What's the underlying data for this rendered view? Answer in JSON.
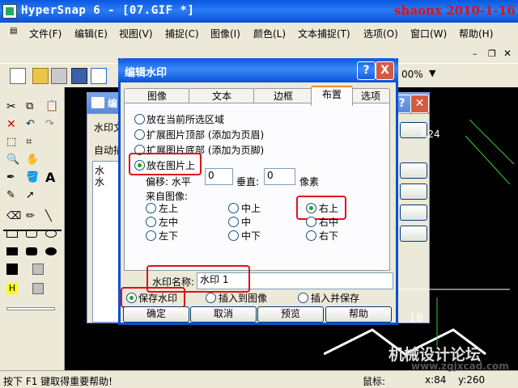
{
  "app": {
    "title": "HyperSnap 6 - [07.GIF *]",
    "watermark": "shaonx 2010-1-16"
  },
  "menubar": [
    "文件(F)",
    "编辑(E)",
    "视图(V)",
    "捕捉(C)",
    "图像(I)",
    "颜色(L)",
    "文本捕捉(T)",
    "选项(O)",
    "窗口(W)",
    "帮助(H)"
  ],
  "toolbar": {
    "zoom": "00%"
  },
  "back_dialog": {
    "title": "编",
    "label1": "水印文",
    "label2": "自动插",
    "list": [
      "水",
      "水"
    ]
  },
  "dialog": {
    "title": "编辑水印",
    "help_btn": "?",
    "close_btn": "X",
    "tabs": [
      "图像",
      "文本",
      "边框",
      "布置",
      "选项"
    ],
    "active_tab": "布置",
    "placement": {
      "options": [
        "放在当前所选区域",
        "扩展图片顶部 (添加为页眉)",
        "扩展图片底部 (添加为页脚)",
        "放在图片上"
      ],
      "selected": "放在图片上",
      "offset_label": "偏移: 水平",
      "h_value": "0",
      "v_label": "垂直:",
      "v_value": "0",
      "unit": "像素",
      "from_label": "来自图像:",
      "positions": [
        [
          "左上",
          "中上",
          "右上"
        ],
        [
          "左中",
          "中",
          "右中"
        ],
        [
          "左下",
          "中下",
          "右下"
        ]
      ],
      "selected_position": "右上"
    },
    "name_label": "水印名称:",
    "name_value": "水印  1",
    "save_options": [
      "保存水印",
      "插入到图像",
      "插入并保存"
    ],
    "save_selected": "保存水印",
    "buttons": [
      "确定",
      "取消",
      "预览",
      "帮助"
    ]
  },
  "statusbar": {
    "help": "按下 F1 键取得重要帮助!",
    "mouse_label": "鼠标:",
    "x": "x:84",
    "y": "y:260"
  },
  "site_watermark": {
    "line1": "机械设计论坛",
    "line2": "www.zgjxcad.com"
  },
  "colors": {
    "titlebar": "#0a58e0",
    "highlight": "#e0101a",
    "radio_dot": "#21a121"
  }
}
